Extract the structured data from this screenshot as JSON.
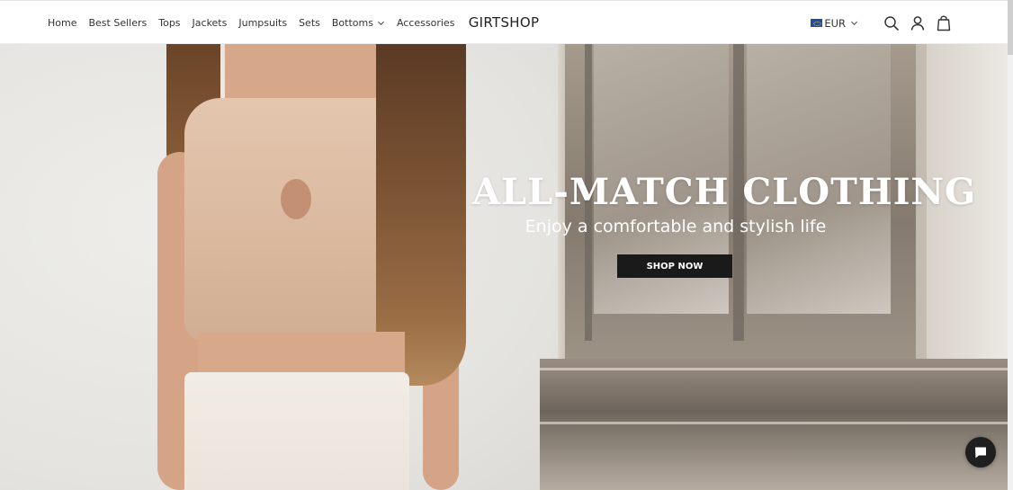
{
  "header": {
    "nav": [
      {
        "label": "Home"
      },
      {
        "label": "Best Sellers"
      },
      {
        "label": "Tops"
      },
      {
        "label": "Jackets"
      },
      {
        "label": "Jumpsuits"
      },
      {
        "label": "Sets"
      },
      {
        "label": "Bottoms",
        "has_dropdown": true
      },
      {
        "label": "Accessories"
      }
    ],
    "logo": "GIRTSHOP",
    "currency": "EUR",
    "icons": [
      "search-icon",
      "account-icon",
      "cart-icon"
    ]
  },
  "hero": {
    "title": "ALL-MATCH CLOTHING",
    "subtitle": "Enjoy a comfortable and stylish life",
    "cta_label": "SHOP NOW"
  },
  "chat": {
    "icon": "chat-icon"
  },
  "colors": {
    "text": "#333333",
    "button_bg": "#1a1a1a",
    "hero_text": "#ffffff"
  }
}
